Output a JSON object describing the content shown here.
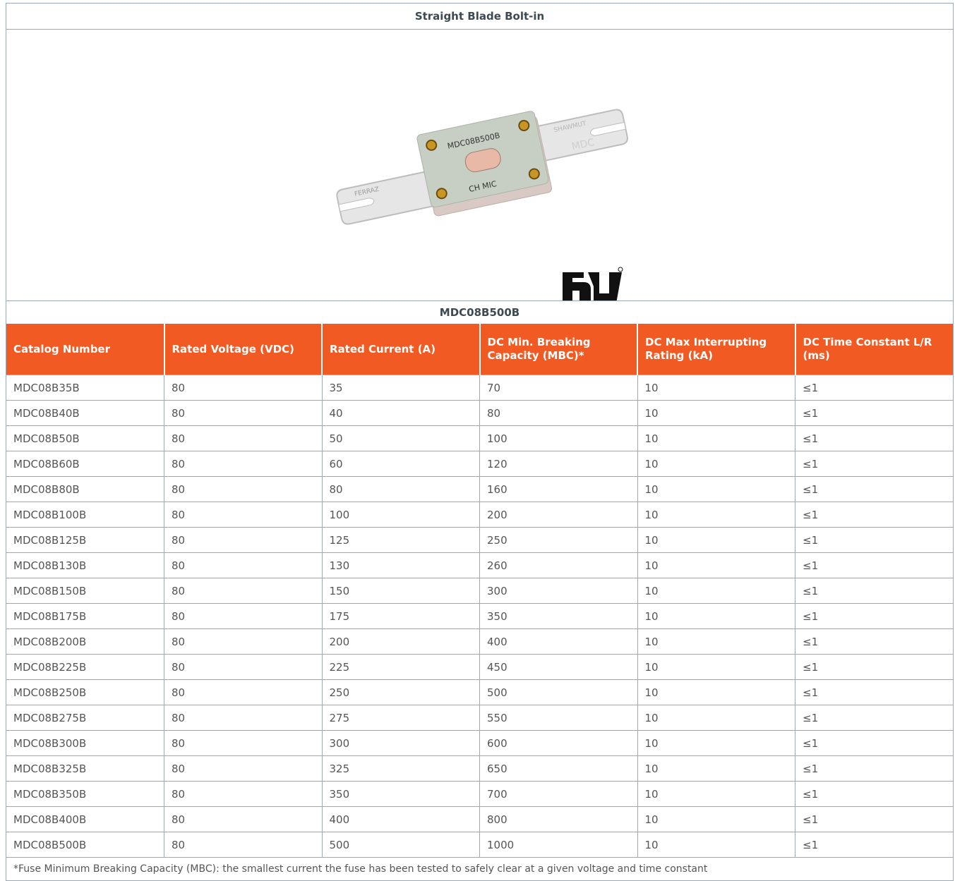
{
  "title": "Straight Blade Bolt-in",
  "product_image": {
    "fuse_text_1": "MDC08B500B",
    "fuse_text_2": "CH MIC",
    "fuse_text_3": "MDC",
    "fuse_text_4": "SHAWMUT",
    "fuse_text_5": "FERRAZ",
    "ul_mark": "UL recognized component mark"
  },
  "model": "MDC08B500B",
  "table": {
    "headers": [
      "Catalog Number",
      "Rated Voltage (VDC)",
      "Rated Current (A)",
      "DC Min. Breaking Capacity (MBC)*",
      "DC Max Interrupting Rating (kA)",
      "DC Time Constant L/R (ms)"
    ],
    "rows": [
      [
        "MDC08B35B",
        "80",
        "35",
        "70",
        "10",
        "≤1"
      ],
      [
        "MDC08B40B",
        "80",
        "40",
        "80",
        "10",
        "≤1"
      ],
      [
        "MDC08B50B",
        "80",
        "50",
        "100",
        "10",
        "≤1"
      ],
      [
        "MDC08B60B",
        "80",
        "60",
        "120",
        "10",
        "≤1"
      ],
      [
        "MDC08B80B",
        "80",
        "80",
        "160",
        "10",
        "≤1"
      ],
      [
        "MDC08B100B",
        "80",
        "100",
        "200",
        "10",
        "≤1"
      ],
      [
        "MDC08B125B",
        "80",
        "125",
        "250",
        "10",
        "≤1"
      ],
      [
        "MDC08B130B",
        "80",
        "130",
        "260",
        "10",
        "≤1"
      ],
      [
        "MDC08B150B",
        "80",
        "150",
        "300",
        "10",
        "≤1"
      ],
      [
        "MDC08B175B",
        "80",
        "175",
        "350",
        "10",
        "≤1"
      ],
      [
        "MDC08B200B",
        "80",
        "200",
        "400",
        "10",
        "≤1"
      ],
      [
        "MDC08B225B",
        "80",
        "225",
        "450",
        "10",
        "≤1"
      ],
      [
        "MDC08B250B",
        "80",
        "250",
        "500",
        "10",
        "≤1"
      ],
      [
        "MDC08B275B",
        "80",
        "275",
        "550",
        "10",
        "≤1"
      ],
      [
        "MDC08B300B",
        "80",
        "300",
        "600",
        "10",
        "≤1"
      ],
      [
        "MDC08B325B",
        "80",
        "325",
        "650",
        "10",
        "≤1"
      ],
      [
        "MDC08B350B",
        "80",
        "350",
        "700",
        "10",
        "≤1"
      ],
      [
        "MDC08B400B",
        "80",
        "400",
        "800",
        "10",
        "≤1"
      ],
      [
        "MDC08B500B",
        "80",
        "500",
        "1000",
        "10",
        "≤1"
      ]
    ]
  },
  "footnote": "*Fuse Minimum Breaking Capacity (MBC): the smallest current the fuse has been tested to safely clear at a given voltage and time constant",
  "colors": {
    "header_bg": "#f15a22",
    "border": "#9aa9b3"
  }
}
